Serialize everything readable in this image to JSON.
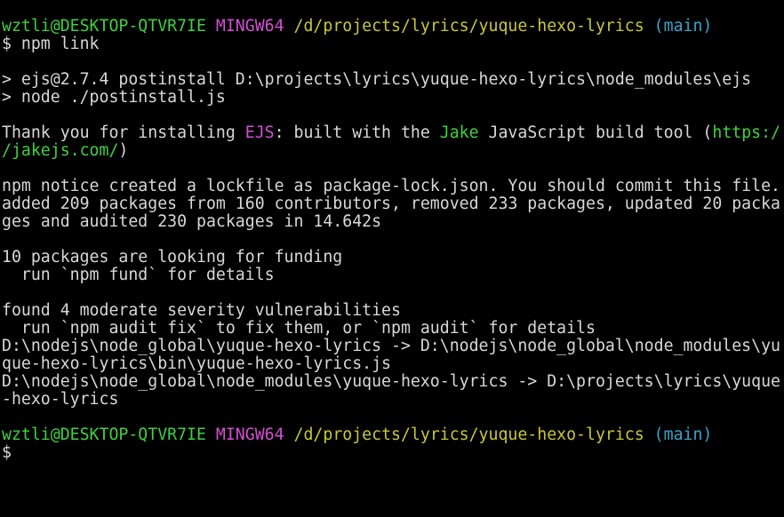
{
  "prompt": {
    "user_host": "wztli@DESKTOP-QTVR7IE",
    "shell": "MINGW64",
    "path": "/d/projects/lyrics/yuque-hexo-lyrics",
    "branch": "(main)",
    "symbol": "$"
  },
  "command": "npm link",
  "output": {
    "postinstall_line1": "> ejs@2.7.4 postinstall D:\\projects\\lyrics\\yuque-hexo-lyrics\\node_modules\\ejs",
    "postinstall_line2": "> node ./postinstall.js",
    "thanks_prefix": "Thank you for installing ",
    "thanks_ejs": "EJS",
    "thanks_middle": ": built with the ",
    "thanks_jake": "Jake",
    "thanks_suffix": " JavaScript build tool (",
    "thanks_url_part1": "https:/",
    "thanks_url_part2": "/jakejs.com/",
    "thanks_close": ")",
    "notice_line": "npm notice created a lockfile as package-lock.json. You should commit this file.",
    "added_line1": "added 209 packages from 160 contributors, removed 233 packages, updated 20 packa",
    "added_line2": "ges and audited 230 packages in 14.642s",
    "funding_line1": "10 packages are looking for funding",
    "funding_line2": "  run `npm fund` for details",
    "vuln_line1": "found 4 moderate severity vulnerabilities",
    "vuln_line2": "  run `npm audit fix` to fix them, or `npm audit` for details",
    "link_line1": "D:\\nodejs\\node_global\\yuque-hexo-lyrics -> D:\\nodejs\\node_global\\node_modules\\yu",
    "link_line2": "que-hexo-lyrics\\bin\\yuque-hexo-lyrics.js",
    "link_line3": "D:\\nodejs\\node_global\\node_modules\\yuque-hexo-lyrics -> D:\\projects\\lyrics\\yuque",
    "link_line4": "-hexo-lyrics"
  },
  "colors": {
    "background": "#000000",
    "text": "#c0c0c0",
    "green": "#3ed23e",
    "magenta": "#d34fd3",
    "yellow": "#c8c83a",
    "cyan": "#3aa3c8"
  }
}
